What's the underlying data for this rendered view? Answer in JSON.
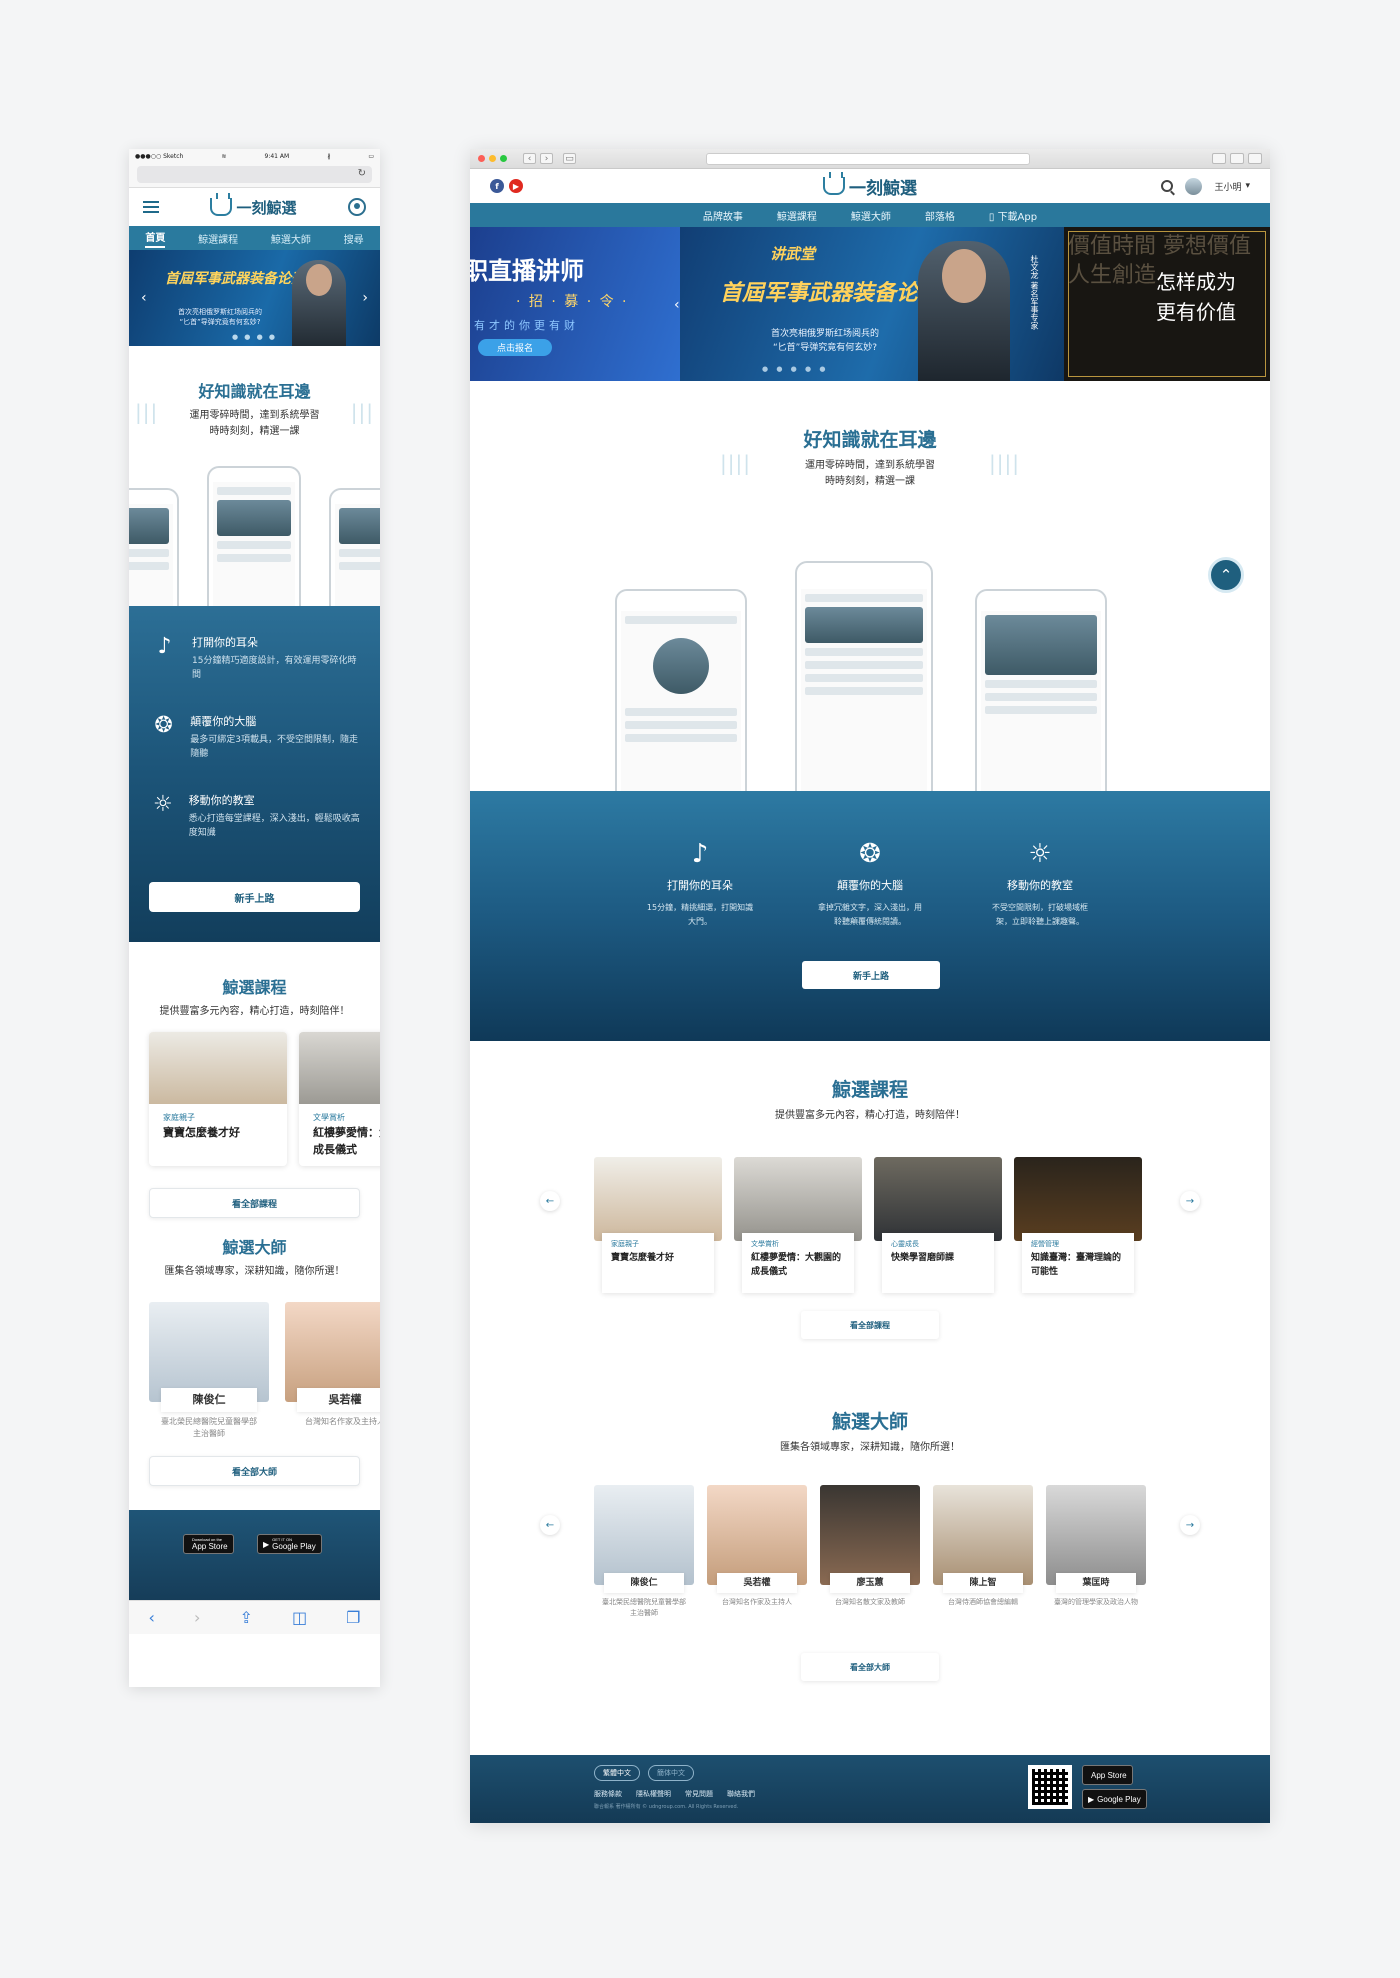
{
  "mobile": {
    "status": {
      "carrier": "●●●○○ Sketch",
      "wifi": "≋",
      "time": "9:41 AM",
      "bluetooth": "∦",
      "battery": "▭"
    },
    "refresh_icon": "↻",
    "app_name": "一刻鯨選",
    "nav": [
      "首頁",
      "鯨選課程",
      "鯨選大師",
      "搜尋"
    ],
    "banner": {
      "title": "首屆军事武器装备论开讲",
      "subtitle": "首次亮相俄罗斯红场阅兵的\n“匕首”导弹究竟有何玄妙?"
    },
    "intro": {
      "title": "好知識就在耳邊",
      "subtitle_line1": "運用零碎時間，達到系統學習",
      "subtitle_line2": "時時刻刻，精選一課"
    },
    "features": [
      {
        "icon": "ear-icon",
        "title": "打開你的耳朵",
        "desc": "15分鐘精巧適度設計，有效運用零碎化時間"
      },
      {
        "icon": "brain-icon",
        "title": "顛覆你的大腦",
        "desc": "最多可綁定3項載具，不受空間限制，隨走隨聽"
      },
      {
        "icon": "bulb-icon",
        "title": "移動你的教室",
        "desc": "悉心打造每堂課程，深入淺出，輕鬆吸收高度知識"
      }
    ],
    "cta": "新手上路",
    "courses": {
      "title": "鯨選課程",
      "subtitle": "提供豐富多元內容，精心打造，時刻陪伴！",
      "items": [
        {
          "category": "家庭親子",
          "name": "寶寶怎麼養才好"
        },
        {
          "category": "文學賞析",
          "name": "紅樓夢愛情：大觀園的成長儀式"
        }
      ],
      "more": "看全部課程"
    },
    "masters": {
      "title": "鯨選大師",
      "subtitle": "匯集各領域專家，深耕知識，隨你所選！",
      "items": [
        {
          "name": "陳俊仁",
          "desc": "臺北榮民總醫院兒童醫學部主治醫師"
        },
        {
          "name": "吳若權",
          "desc": "台灣知名作家及主持人"
        }
      ],
      "more": "看全部大師"
    },
    "store": {
      "appstore_small": "Download on the",
      "appstore": "App Store",
      "google_small": "GET IT ON",
      "google": "Google Play"
    },
    "toolbar": [
      "‹",
      "›",
      "⇪",
      "◫",
      "❐"
    ]
  },
  "desktop": {
    "app_name": "一刻鯨選",
    "social": [
      "f",
      "▶"
    ],
    "user": "王小明",
    "nav": [
      "品牌故事",
      "鯨選課程",
      "鯨選大師",
      "部落格",
      "下載App"
    ],
    "banner": {
      "left_title": "职直播讲师",
      "left_sub": "· 招 · 募 · 令 ·",
      "left_sub2": "有才的你更有财",
      "left_btn": "点击报名",
      "mid_brand": "讲武堂",
      "mid_title": "首屆军事武器装备论开讲",
      "mid_sub": "首次亮相俄罗斯红场阅兵的\n“匕首”导弹究竟有何玄妙?",
      "mid_vert": "杜文龙 著名军事专家",
      "right_title": "怎样成为\n更有价值"
    },
    "intro": {
      "title": "好知識就在耳邊",
      "subtitle_line1": "運用零碎時間，達到系統學習",
      "subtitle_line2": "時時刻刻，精選一課"
    },
    "features": [
      {
        "icon": "ear-icon",
        "title": "打開你的耳朵",
        "desc": "15分鐘，精挑細選，打開知識大門。"
      },
      {
        "icon": "brain-icon",
        "title": "顛覆你的大腦",
        "desc": "拿掉冗雜文字，深入淺出，用聆聽顛覆傳統閱讀。"
      },
      {
        "icon": "bulb-icon",
        "title": "移動你的教室",
        "desc": "不受空間限制，打破場域框架，立即聆聽上課趣聲。"
      }
    ],
    "cta": "新手上路",
    "courses": {
      "title": "鯨選課程",
      "subtitle": "提供豐富多元內容，精心打造，時刻陪伴！",
      "items": [
        {
          "category": "家庭親子",
          "name": "寶寶怎麼養才好"
        },
        {
          "category": "文學賞析",
          "name": "紅樓夢愛情：大觀園的成長儀式"
        },
        {
          "category": "心靈成長",
          "name": "快樂學習磨師課"
        },
        {
          "category": "經營管理",
          "name": "知識臺灣：臺灣理論的可能性"
        }
      ],
      "more": "看全部課程"
    },
    "masters": {
      "title": "鯨選大師",
      "subtitle": "匯集各領域專家，深耕知識，隨你所選！",
      "items": [
        {
          "name": "陳俊仁",
          "desc": "臺北榮民總醫院兒童醫學部主治醫師"
        },
        {
          "name": "吳若權",
          "desc": "台灣知名作家及主持人"
        },
        {
          "name": "廖玉蕙",
          "desc": "台灣知名散文家及教師"
        },
        {
          "name": "陳上智",
          "desc": "台灣侍酒師協會總編輯"
        },
        {
          "name": "葉匡時",
          "desc": "臺灣的管理學家及政治人物"
        }
      ],
      "more": "看全部大師"
    },
    "footer": {
      "lang_active": "繁體中文",
      "lang_other": "簡体中文",
      "links": [
        "服務條款",
        "隱私權聲明",
        "常見問題",
        "聯絡我們"
      ],
      "copyright": "聯合報系 著作權所有 © udngroup.com. All Rights Reserved.",
      "appstore": "App Store",
      "google": "Google Play"
    }
  }
}
